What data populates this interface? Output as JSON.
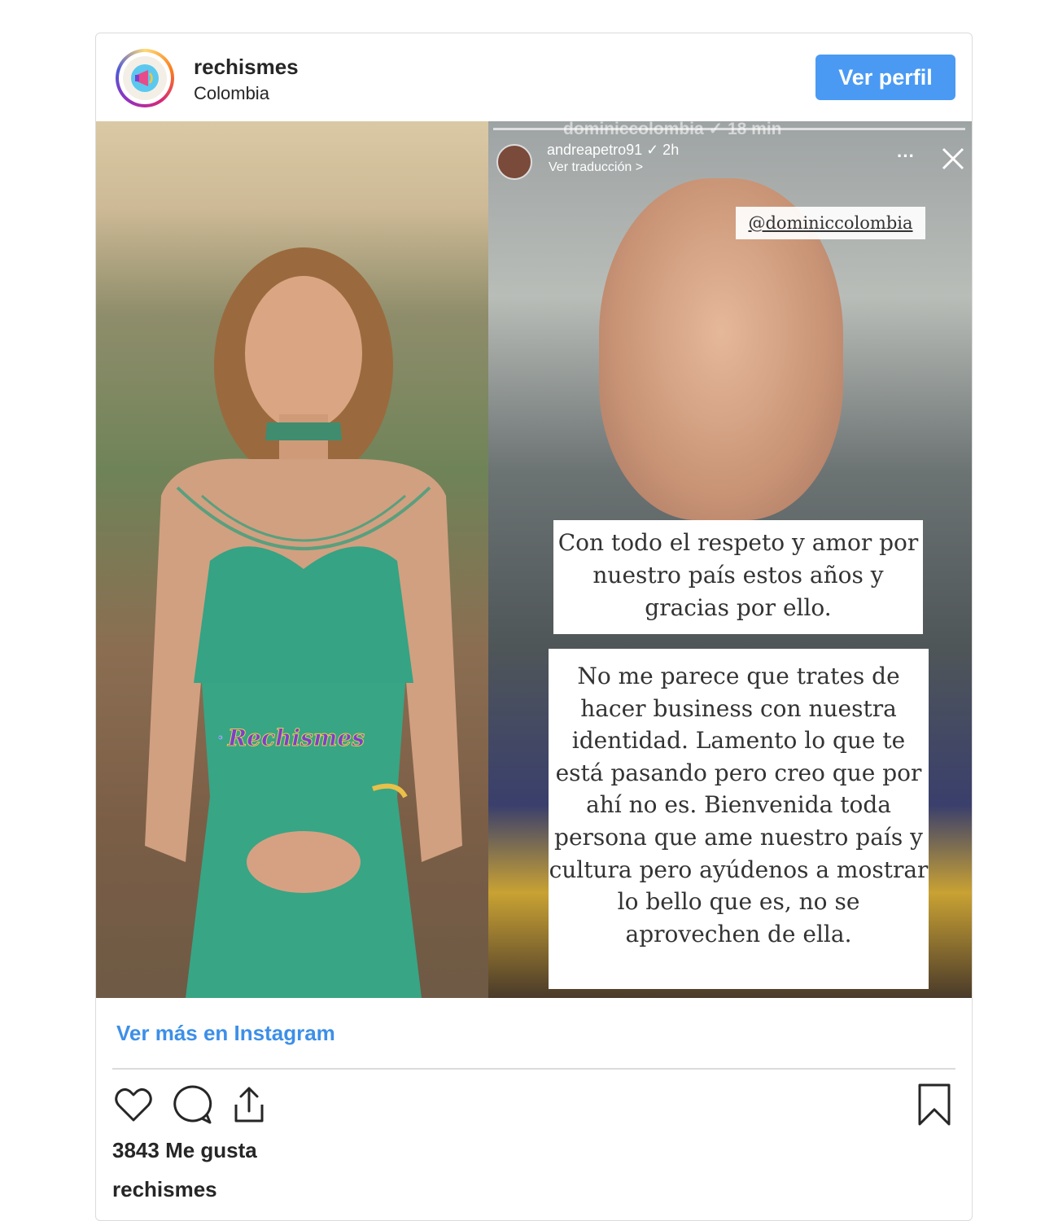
{
  "header": {
    "username": "rechismes",
    "location": "Colombia",
    "view_profile_label": "Ver perfil"
  },
  "story": {
    "ghost_username": "dominiccolombia ✓  18 min",
    "username": "andreapetro91 ✓ 2h",
    "translate_label": "Ver traducción >",
    "mention": "@dominiccolombia",
    "text_block_1": "Con todo el respeto y amor por nuestro país estos años y gracias por ello.",
    "text_block_2": "No me parece que trates de hacer business con nuestra identidad. Lamento lo que te está pasando pero creo que por ahí no es. Bienvenida toda persona que ame nuestro país y cultura pero ayúdenos a mostrar lo bello que es, no se aprovechen de ella."
  },
  "watermark": {
    "text": "Rechismes"
  },
  "footer": {
    "more_link": "Ver más en Instagram",
    "likes": "3843 Me gusta",
    "caption_username": "rechismes"
  },
  "icons": [
    "heart-icon",
    "comment-icon",
    "share-icon",
    "bookmark-icon",
    "megaphone-icon",
    "close-icon",
    "more-icon"
  ],
  "colors": {
    "button": "#4a9af4",
    "link": "#3d8fe8",
    "text": "#262626",
    "border": "#dbdbdb"
  }
}
